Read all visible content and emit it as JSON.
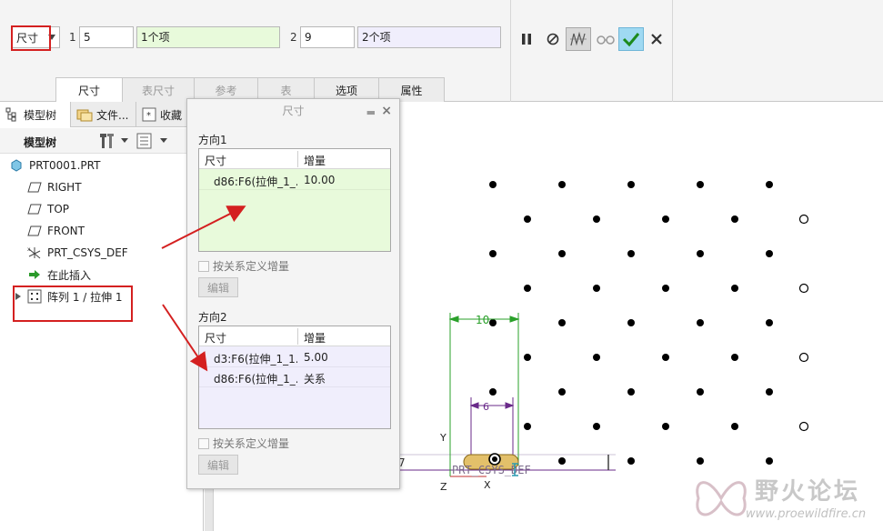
{
  "ribbon": {
    "type_select": "尺寸",
    "dir1": {
      "num": "1",
      "count": "5",
      "items": "1个项"
    },
    "dir2": {
      "num": "2",
      "count": "9",
      "items": "2个项"
    },
    "tools": [
      "pause-icon",
      "no-preview-icon",
      "pattern-preview-icon",
      "glasses-icon",
      "confirm-check-icon",
      "cancel-x-icon"
    ],
    "tabs": [
      {
        "label": "尺寸",
        "state": "active"
      },
      {
        "label": "表尺寸",
        "state": "disabled"
      },
      {
        "label": "参考",
        "state": "disabled"
      },
      {
        "label": "表",
        "state": "disabled"
      },
      {
        "label": "选项",
        "state": "enabled"
      },
      {
        "label": "属性",
        "state": "enabled"
      }
    ]
  },
  "left_panel": {
    "tabs": [
      "模型树",
      "文件...",
      "收藏"
    ],
    "toolbar_title": "模型树",
    "tree": [
      {
        "label": "PRT0001.PRT",
        "icon": "part-icon"
      },
      {
        "label": "RIGHT",
        "icon": "datum-plane-icon"
      },
      {
        "label": "TOP",
        "icon": "datum-plane-icon"
      },
      {
        "label": "FRONT",
        "icon": "datum-plane-icon"
      },
      {
        "label": "PRT_CSYS_DEF",
        "icon": "csys-icon"
      },
      {
        "label": "在此插入",
        "icon": "insert-arrow-icon"
      },
      {
        "label": "阵列 1 / 拉伸 1",
        "icon": "pattern-icon"
      }
    ]
  },
  "dialog": {
    "title": "尺寸",
    "dir1": {
      "label": "方向1",
      "headers": [
        "尺寸",
        "增量"
      ],
      "rows": [
        {
          "dim": "d86:F6(拉伸_1_...",
          "inc": "10.00"
        }
      ],
      "checkbox": "按关系定义增量",
      "edit": "编辑"
    },
    "dir2": {
      "label": "方向2",
      "headers": [
        "尺寸",
        "增量"
      ],
      "rows": [
        {
          "dim": "d3:F6(拉伸_1_1...",
          "inc": "5.00"
        },
        {
          "dim": "d86:F6(拉伸_1_...",
          "inc": "关系"
        }
      ],
      "checkbox": "按关系定义增量",
      "edit": "编辑"
    }
  },
  "viewport": {
    "csys_label": "PRT_CSYS_DEF",
    "dim_10": "10",
    "dim_6": "6",
    "axis_y": "Y",
    "axis_z": "Z",
    "axis_x": "X",
    "left_mark": "7"
  },
  "watermark": {
    "title": "野火论坛",
    "url": "www.proewildfire.cn"
  },
  "colors": {
    "highlight_red": "#d42020",
    "dir1_green": "#e8fadb",
    "dir2_purple": "#f0eefc",
    "dim_green": "#2aa02a",
    "dim_purple": "#6a2a8a",
    "confirm_blue": "#9fd9f2"
  }
}
